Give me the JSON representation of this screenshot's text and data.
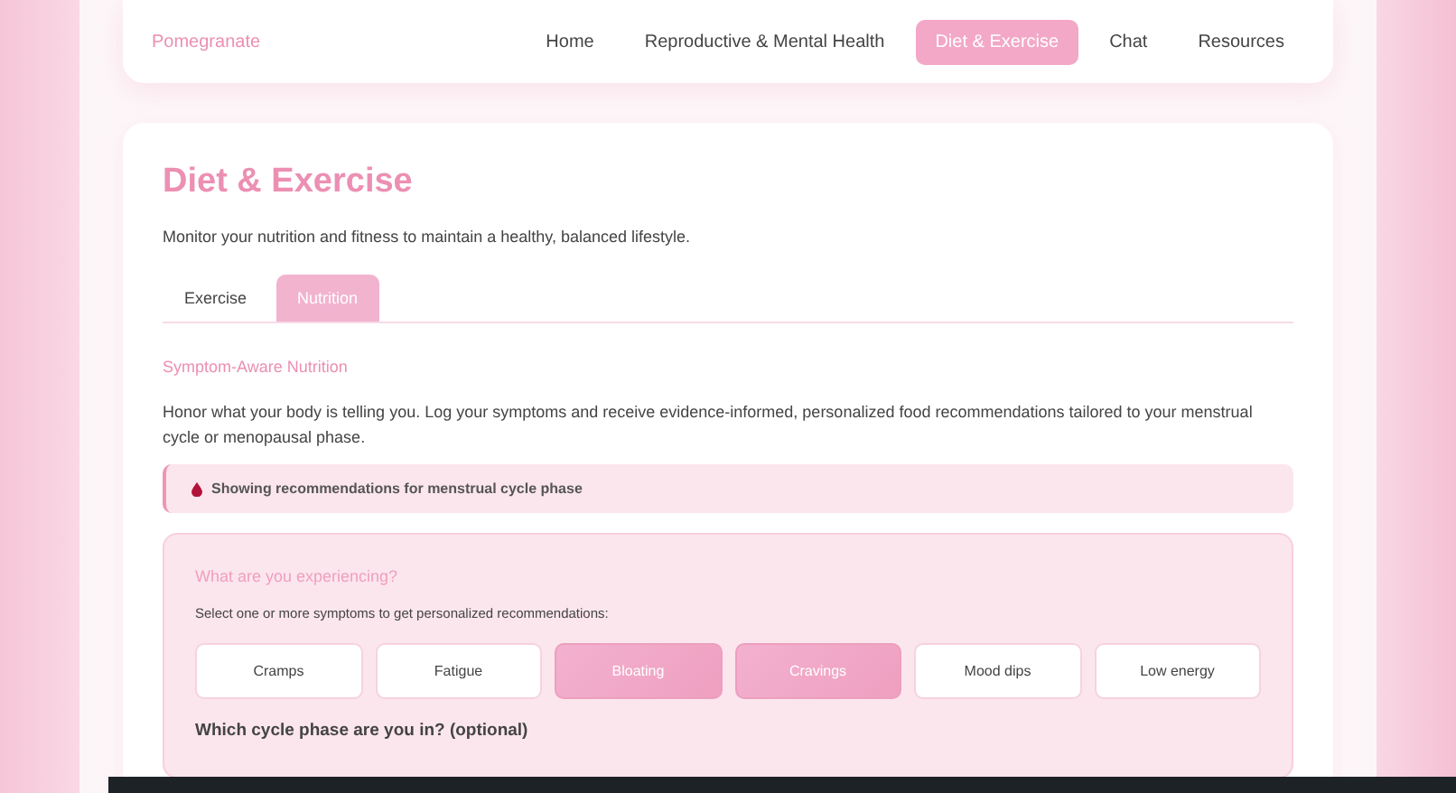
{
  "brand": "Pomegranate",
  "nav": [
    {
      "label": "Home",
      "selected": false
    },
    {
      "label": "Reproductive & Mental Health",
      "selected": false
    },
    {
      "label": "Diet & Exercise",
      "selected": true
    },
    {
      "label": "Chat",
      "selected": false
    },
    {
      "label": "Resources",
      "selected": false
    }
  ],
  "title": "Diet & Exercise",
  "subtitle": "Monitor your nutrition and fitness to maintain a healthy, balanced lifestyle.",
  "tabs": [
    {
      "label": "Exercise",
      "selected": false
    },
    {
      "label": "Nutrition",
      "selected": true
    }
  ],
  "section_title": "Symptom-Aware Nutrition",
  "intro": "Honor what your body is telling you. Log your symptoms and receive evidence-informed, personalized food recommendations tailored to your menstrual cycle or menopausal phase.",
  "notice": "Showing recommendations for menstrual cycle phase",
  "panel": {
    "title": "What are you experiencing?",
    "hint": "Select one or more symptoms to get personalized recommendations:",
    "symptoms": [
      {
        "label": "Cramps",
        "selected": false
      },
      {
        "label": "Fatigue",
        "selected": false
      },
      {
        "label": "Bloating",
        "selected": true
      },
      {
        "label": "Cravings",
        "selected": true
      },
      {
        "label": "Mood dips",
        "selected": false
      },
      {
        "label": "Low energy",
        "selected": false
      }
    ],
    "phase_question": "Which cycle phase are you in? (optional)"
  }
}
